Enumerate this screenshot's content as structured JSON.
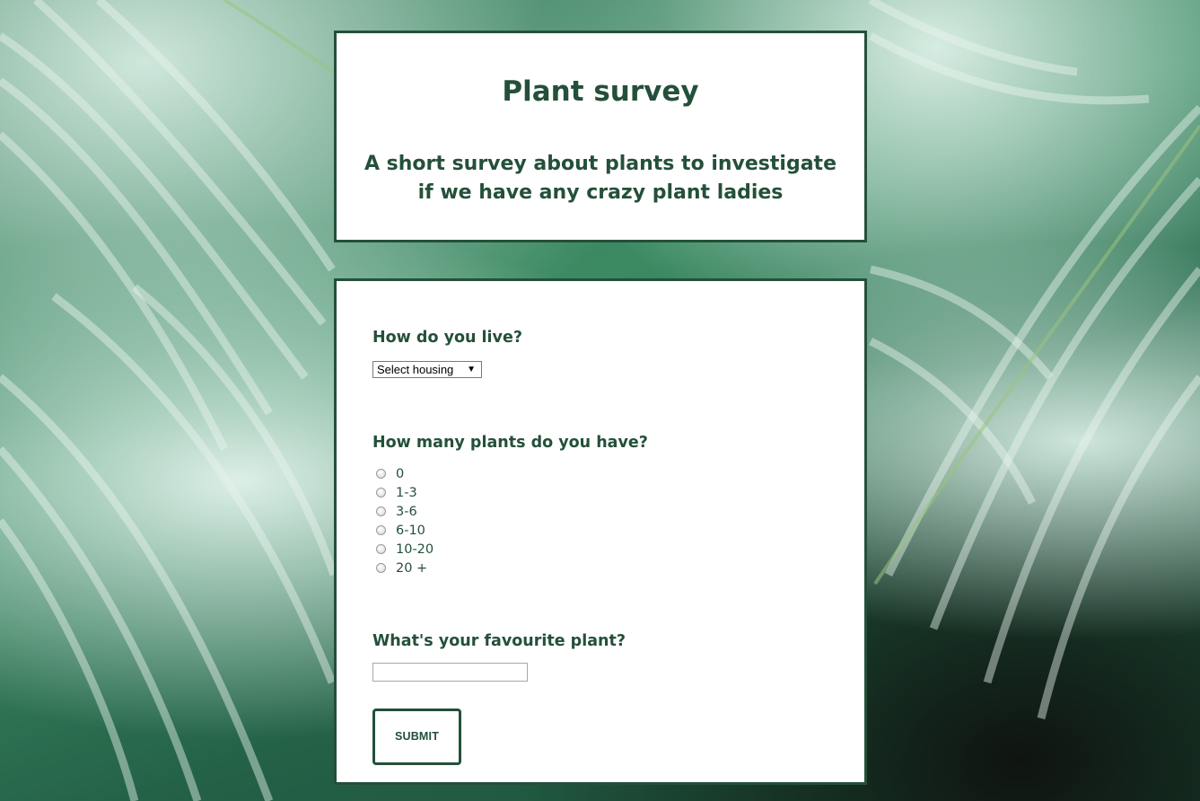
{
  "header": {
    "title": "Plant survey",
    "subtitle": "A short survey about plants to investigate if we have any crazy plant ladies"
  },
  "form": {
    "housing": {
      "question": "How do you live?",
      "selected": "Select housing"
    },
    "plant_count": {
      "question": "How many plants do you have?",
      "options": [
        "0",
        "1-3",
        "3-6",
        "6-10",
        "10-20",
        "20 +"
      ]
    },
    "favourite": {
      "question": "What's your favourite plant?",
      "value": "",
      "placeholder": ""
    },
    "submit_label": "SUBMIT"
  },
  "colors": {
    "accent": "#24503a",
    "card_background": "#ffffff"
  },
  "icons": {
    "select_arrow": "chevron-down-icon"
  }
}
